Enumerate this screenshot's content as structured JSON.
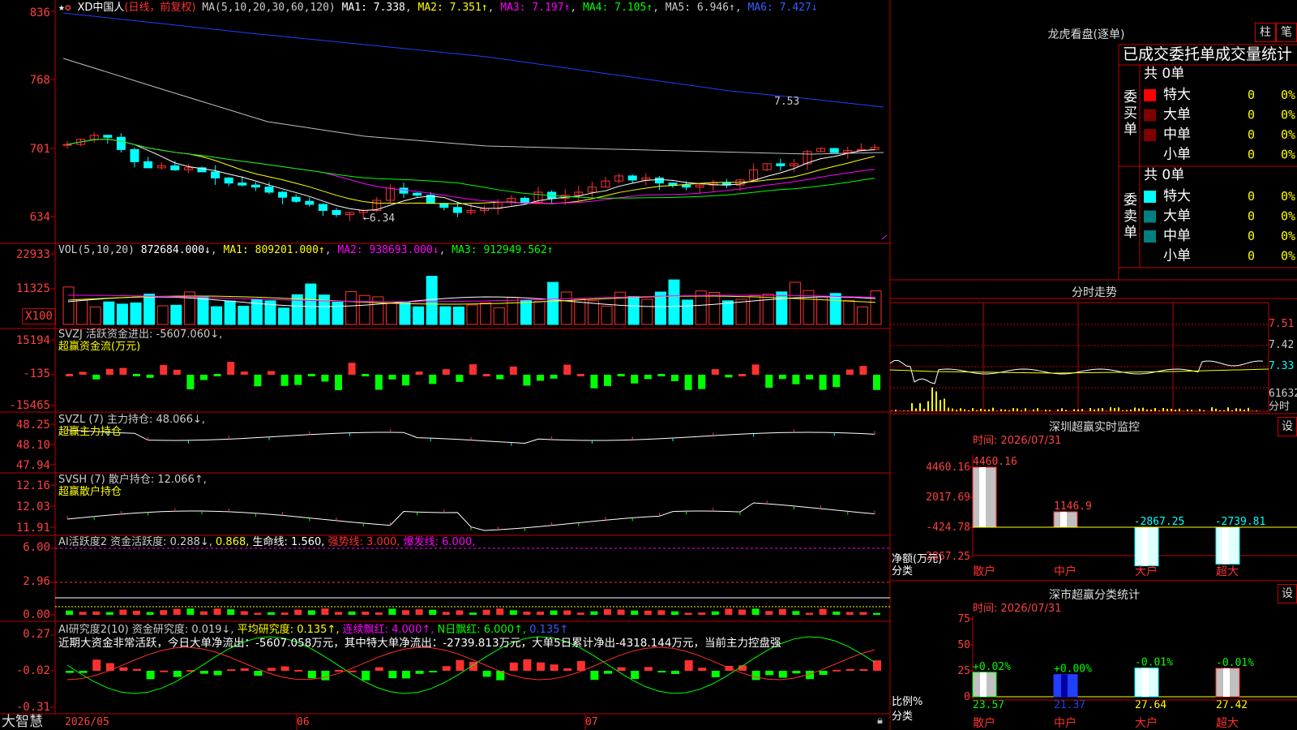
{
  "colors": {
    "up": "#ff3030",
    "down": "#00ffff",
    "vol_down": "#00ffff",
    "bg": "#000000",
    "grid": "#c00000",
    "ma1": "#ffffff",
    "ma2": "#ffff00",
    "ma3": "#ff00ff",
    "ma4": "#00ff00",
    "ma5": "#c0c0c0",
    "ma6": "#0000ff"
  },
  "kline": {
    "star_icon": "star-icon",
    "stock_name": "XD中国人",
    "mode": "(日线，前复权)",
    "ma_label": "MA(5,10,20,30,60,120)",
    "ma1": "MA1: 7.338",
    "ma2": "MA2: 7.351↑",
    "ma3": "MA3: 7.197↑",
    "ma4": "MA4: 7.105↑",
    "ma5": "MA5: 6.946↑",
    "ma6": "MA6: 7.427↓",
    "high_label": "7.53",
    "low_label": "←6.34",
    "axis": [
      "836",
      "768",
      "701",
      "634"
    ]
  },
  "volume": {
    "title": "VOL(5,10,20)",
    "val": "872684.000↓",
    "ma1": "MA1: 809201.000↑",
    "ma2": "MA2: 938693.000↓",
    "ma3": "MA3: 912949.562↑",
    "axis": [
      "22933",
      "11325",
      "X100"
    ]
  },
  "svzj": {
    "title": "SVZJ  活跃资金进出: -5607.060↓,",
    "sub": "超赢资金流(万元)",
    "axis": [
      "15194",
      "-135",
      "-15465"
    ]
  },
  "svzl": {
    "title": "SVZL (7) 主力持仓: 48.066↓,",
    "sub": "超赢主力持仓",
    "axis": [
      "48.25",
      "48.10",
      "47.94"
    ]
  },
  "svsh": {
    "title": "SVSH (7) 散户持仓: 12.066↑,",
    "sub": "超赢散户持仓",
    "axis": [
      "12.16",
      "12.03",
      "11.91"
    ]
  },
  "ai_active": {
    "title": "AI活跃度2 资金活跃度: 0.288↓,",
    "v2": "0.868,",
    "life": "生命线: 1.560,",
    "strong": "强势线: 3.000,",
    "burst": "爆发线: 6.000,",
    "axis": [
      "6.00",
      "2.96",
      "0.00"
    ]
  },
  "ai_research": {
    "title": "AI研究度2(10) 资金研究度: 0.019↓,",
    "avg": "平均研究度: 0.135↑,",
    "red": "连续飘红: 4.000↑,",
    "n": "N日飘红: 6.000↑,",
    "last": "0.135↑",
    "summary": "近期大资金非常活跃，今日大单净流出：-5607.058万元，其中特大单净流出：-2739.813万元，大单5日累计净出-4318.144万元，当前主力控盘强",
    "axis": [
      "0.27",
      "-0.02",
      "-0.31"
    ]
  },
  "footer": {
    "brand": "大智慧",
    "dates": [
      "2026/05",
      "06",
      "07"
    ]
  },
  "right": {
    "dragon_title": "龙虎看盘(逐单)",
    "btn_bar": "柱",
    "btn_pen": "笔",
    "tabs": "已成交委托单成交量统计",
    "buy_label": "委买单",
    "sell_label": "委卖单",
    "buy_total": "共 0单",
    "sell_total": "共 0单",
    "buy_rows": [
      {
        "name": "特大",
        "n": "0",
        "p": "0%",
        "c": "#ff0000"
      },
      {
        "name": "大单",
        "n": "0",
        "p": "0%",
        "c": "#800000"
      },
      {
        "name": "中单",
        "n": "0",
        "p": "0%",
        "c": "#800000"
      },
      {
        "name": "小单",
        "n": "0",
        "p": "0%",
        "c": ""
      }
    ],
    "sell_rows": [
      {
        "name": "特大",
        "n": "0",
        "p": "0%",
        "c": "#00ffff"
      },
      {
        "name": "大单",
        "n": "0",
        "p": "0%",
        "c": "#008080"
      },
      {
        "name": "中单",
        "n": "0",
        "p": "0%",
        "c": "#008080"
      },
      {
        "name": "小单",
        "n": "0",
        "p": "0%",
        "c": ""
      }
    ],
    "intraday_title": "分时走势",
    "intraday_axis": [
      "7.51",
      "7.42",
      "7.33",
      "61632",
      "分时"
    ],
    "monitor_title": "深圳超赢实时监控",
    "monitor_btn": "设",
    "monitor_time": "时间: 2026/07/31",
    "monitor_axis": [
      "4460.16",
      "2017.69",
      "-424.78",
      "-2867.25"
    ],
    "monitor_bars": [
      {
        "cat": "散户",
        "val": 4460.16,
        "label": "4460.16"
      },
      {
        "cat": "中户",
        "val": 1146.9,
        "label": "1146.9"
      },
      {
        "cat": "大户",
        "val": -2867.25,
        "label": "-2867.25"
      },
      {
        "cat": "超大",
        "val": -2739.81,
        "label": "-2739.81"
      }
    ],
    "monitor_ylabel": "净额(万元)",
    "monitor_xlabel": "分类",
    "class_title": "深市超赢分类统计",
    "class_btn": "设",
    "class_time": "时间: 2026/07/31",
    "class_axis": [
      "75",
      "50",
      "25",
      "0"
    ],
    "class_bars": [
      {
        "cat": "散户",
        "val": 23.57,
        "chg": "+0.02%",
        "label": "23.57"
      },
      {
        "cat": "中户",
        "val": 21.37,
        "chg": "+0.00%",
        "label": "21.37"
      },
      {
        "cat": "大户",
        "val": 27.64,
        "chg": "-0.01%",
        "label": "27.64"
      },
      {
        "cat": "超大",
        "val": 27.42,
        "chg": "-0.01%",
        "label": "27.42"
      }
    ],
    "class_ylabel": "比例%",
    "class_xlabel": "分类"
  }
}
